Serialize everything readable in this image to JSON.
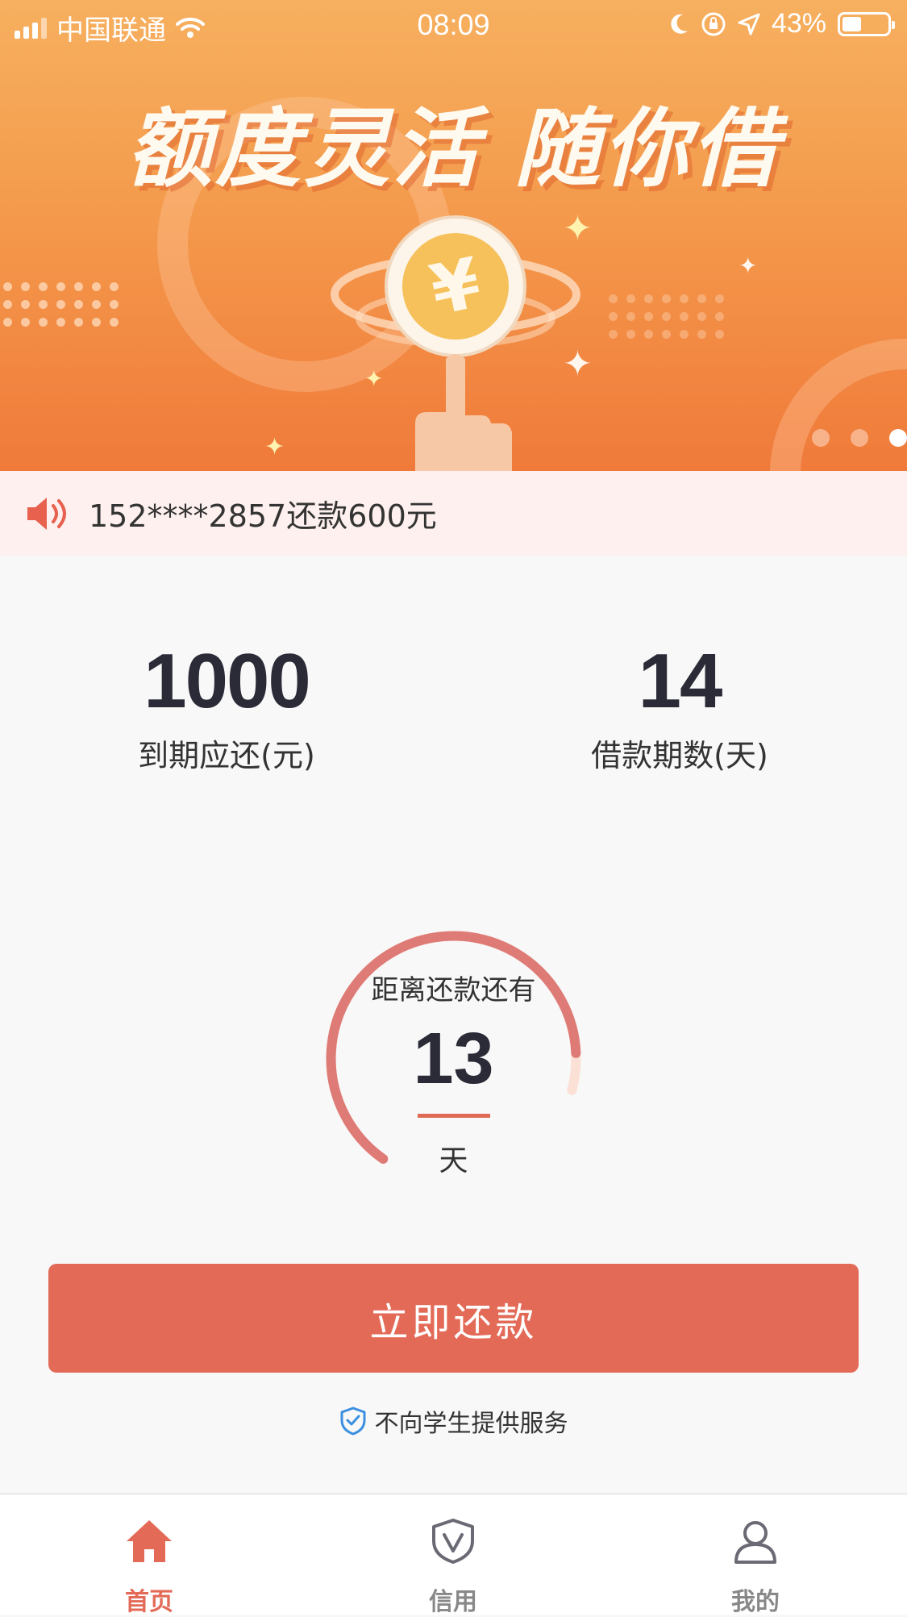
{
  "status_bar": {
    "carrier": "中国联通",
    "time": "08:09",
    "battery": "43%",
    "battery_level": 0.43,
    "icons": [
      "signal-icon",
      "wifi-icon",
      "moon-icon",
      "rotation-lock-icon",
      "location-icon",
      "battery-icon"
    ]
  },
  "banner": {
    "slogan": "额度灵活 随你借",
    "image": "coin-on-finger-illustration",
    "slides_total": 3,
    "active_slide": 3
  },
  "notice": {
    "icon": "speaker-icon",
    "text": "152****2857还款600元"
  },
  "stats": {
    "due_amount": {
      "value": "1000",
      "label": "到期应还(元)"
    },
    "loan_term": {
      "value": "14",
      "label": "借款期数(天)"
    }
  },
  "countdown": {
    "caption": "距离还款还有",
    "days": "13",
    "unit": "天",
    "progress": 0.93
  },
  "action": {
    "repay_label": "立即还款"
  },
  "disclaimer": {
    "icon": "shield-check-icon",
    "text": "不向学生提供服务"
  },
  "tabs": [
    {
      "label": "首页",
      "icon": "home-icon",
      "active": true
    },
    {
      "label": "信用",
      "icon": "credit-shield-icon",
      "active": false
    },
    {
      "label": "我的",
      "icon": "user-icon",
      "active": false
    }
  ],
  "colors": {
    "accent": "#e36a57",
    "banner": "#f49a4c",
    "ring_track": "#fbe0d6"
  }
}
